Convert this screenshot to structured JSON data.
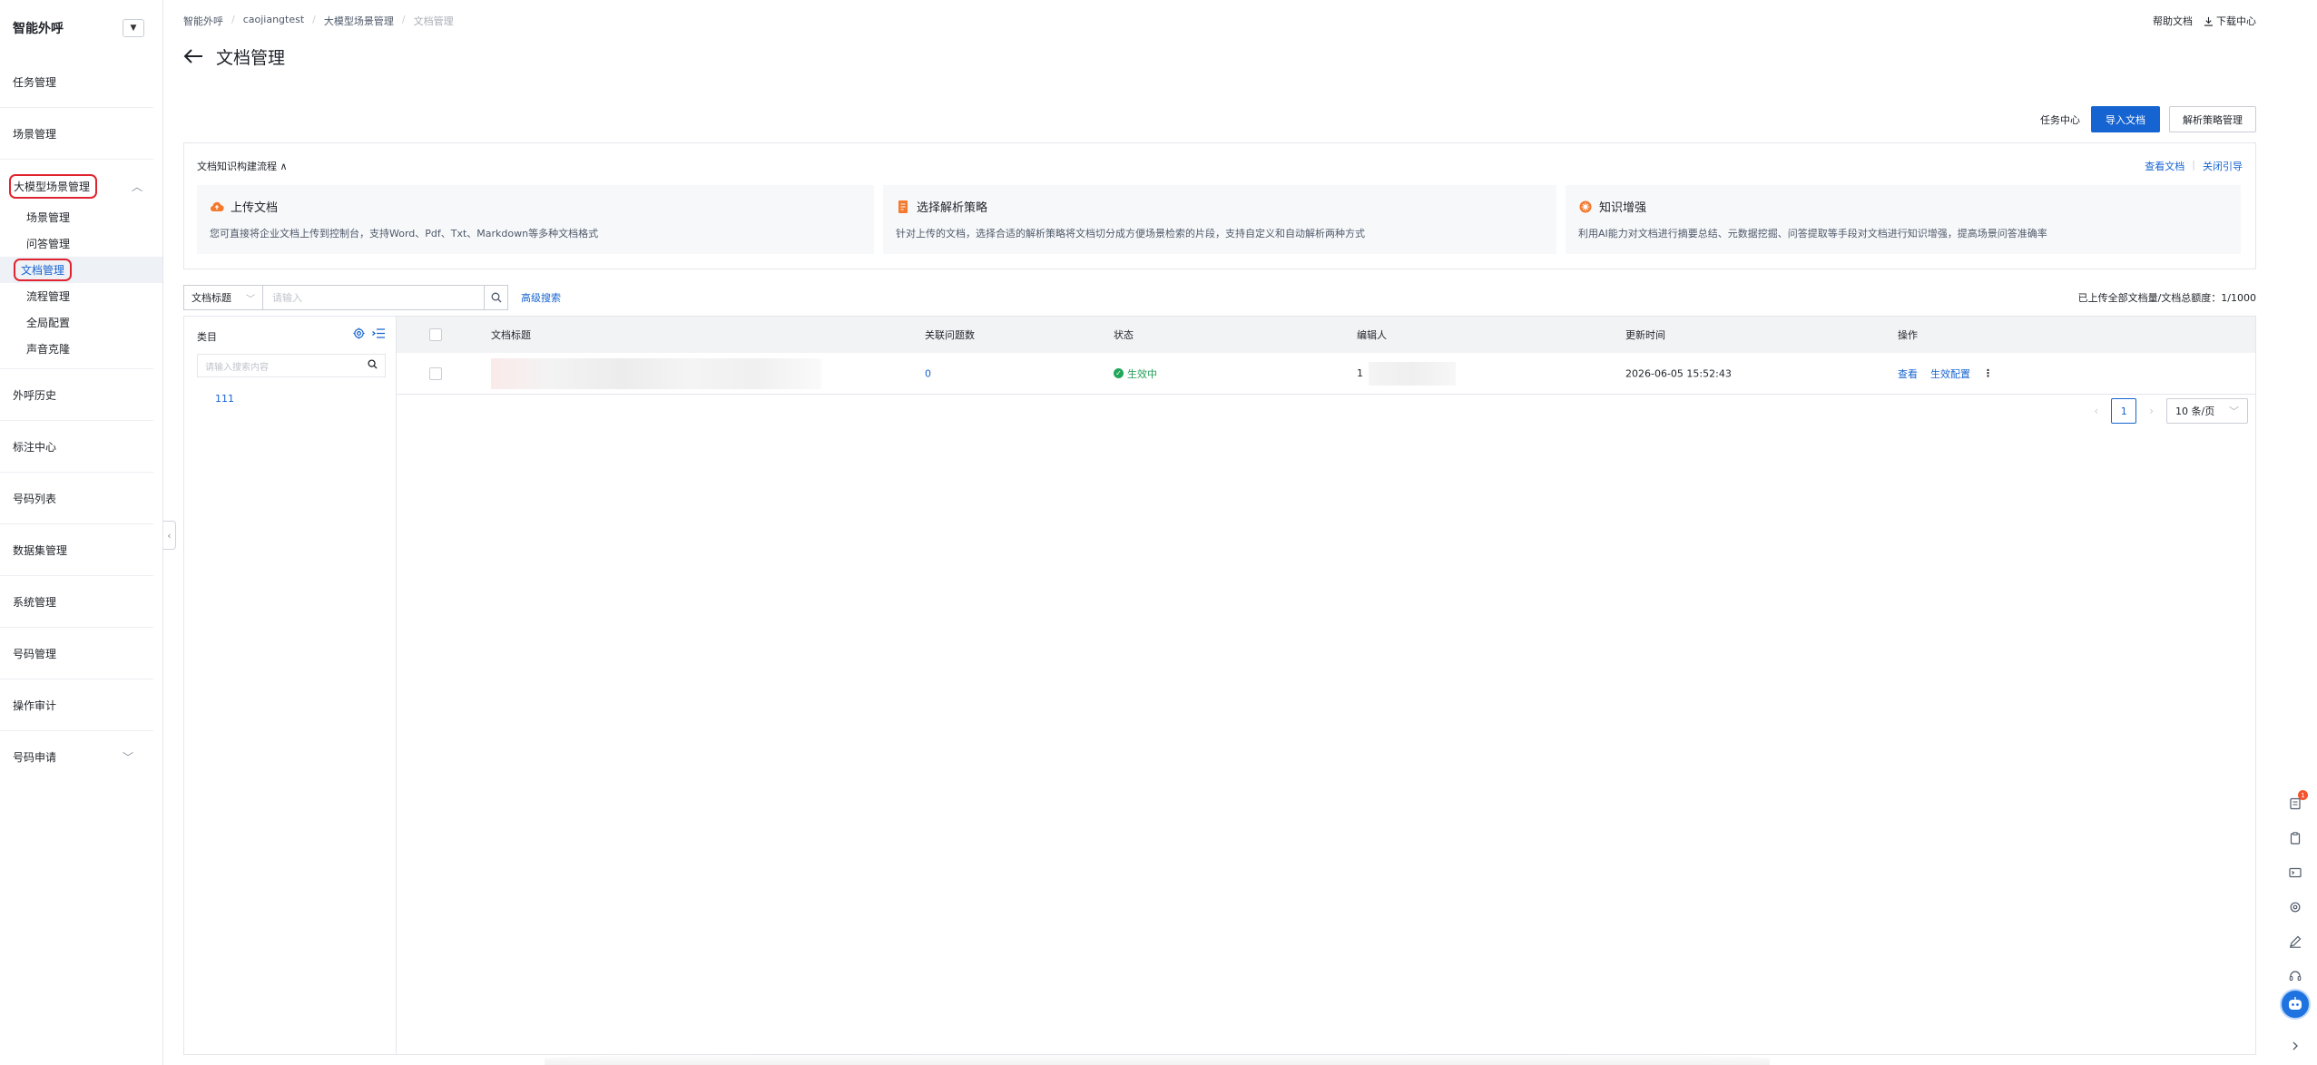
{
  "sidebar": {
    "title": "智能外呼",
    "items_top": [
      {
        "label": "任务管理"
      },
      {
        "label": "场景管理"
      }
    ],
    "group": {
      "label": "大模型场景管理",
      "children": [
        {
          "label": "场景管理"
        },
        {
          "label": "问答管理"
        },
        {
          "label": "文档管理",
          "active": true
        },
        {
          "label": "流程管理"
        },
        {
          "label": "全局配置"
        },
        {
          "label": "声音克隆"
        }
      ]
    },
    "items_bottom": [
      {
        "label": "外呼历史"
      },
      {
        "label": "标注中心"
      },
      {
        "label": "号码列表"
      },
      {
        "label": "数据集管理"
      },
      {
        "label": "系统管理"
      },
      {
        "label": "号码管理"
      },
      {
        "label": "操作审计"
      },
      {
        "label": "号码申请"
      }
    ]
  },
  "breadcrumb": [
    "智能外呼",
    "caojiangtest",
    "大模型场景管理",
    "文档管理"
  ],
  "top_links": {
    "help": "帮助文档",
    "download": "下载中心"
  },
  "page_title": "文档管理",
  "actions": {
    "task_center": "任务中心",
    "import": "导入文档",
    "strategy": "解析策略管理"
  },
  "flow": {
    "title": "文档知识构建流程",
    "links": {
      "view": "查看文档",
      "close": "关闭引导"
    },
    "cards": [
      {
        "title": "上传文档",
        "desc": "您可直接将企业文档上传到控制台，支持Word、Pdf、Txt、Markdown等多种文档格式"
      },
      {
        "title": "选择解析策略",
        "desc": "针对上传的文档，选择合适的解析策略将文档切分成方便场景检索的片段，支持自定义和自动解析两种方式"
      },
      {
        "title": "知识增强",
        "desc": "利用AI能力对文档进行摘要总结、元数据挖掘、问答提取等手段对文档进行知识增强，提高场景问答准确率"
      }
    ]
  },
  "search": {
    "field": "文档标题",
    "placeholder": "请输入",
    "advanced": "高级搜索"
  },
  "quota": "已上传全部文档量/文档总额度：1/1000",
  "category": {
    "head": "类目",
    "placeholder": "请输入搜索内容",
    "items": [
      "111"
    ]
  },
  "table": {
    "columns": [
      "文档标题",
      "关联问题数",
      "状态",
      "编辑人",
      "更新时间",
      "操作"
    ],
    "rows": [
      {
        "related": "0",
        "status": "生效中",
        "editor": "1",
        "updated": "2026-06-05 15:52:43",
        "ops": [
          "查看",
          "生效配置"
        ]
      }
    ]
  },
  "pagination": {
    "current": "1",
    "page_size": "10 条/页"
  },
  "colors": {
    "primary": "#1664d1",
    "highlight": "#e0242f",
    "success": "#20a75a"
  }
}
